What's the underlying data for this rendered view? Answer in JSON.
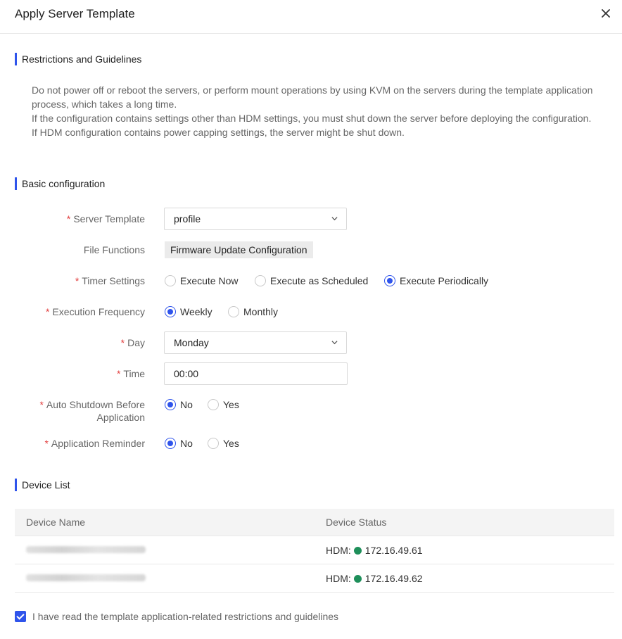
{
  "dialog": {
    "title": "Apply Server Template",
    "close_icon": "close-icon"
  },
  "restrictions": {
    "title": "Restrictions and Guidelines",
    "lines": [
      "Do not power off or reboot the servers, or perform mount operations by using KVM on the servers during the template application process, which takes a long time.",
      "If the configuration contains settings other than HDM settings, you must shut down the server before deploying the configuration.",
      "If HDM configuration contains power capping settings, the server might be shut down."
    ]
  },
  "basic": {
    "title": "Basic configuration",
    "server_template": {
      "label": "Server Template",
      "value": "profile"
    },
    "file_functions": {
      "label": "File Functions",
      "value": "Firmware Update Configuration"
    },
    "timer_settings": {
      "label": "Timer Settings",
      "options": [
        "Execute Now",
        "Execute as Scheduled",
        "Execute Periodically"
      ],
      "selected": "Execute Periodically"
    },
    "execution_frequency": {
      "label": "Execution Frequency",
      "options": [
        "Weekly",
        "Monthly"
      ],
      "selected": "Weekly"
    },
    "day": {
      "label": "Day",
      "value": "Monday"
    },
    "time": {
      "label": "Time",
      "value": "00:00"
    },
    "auto_shutdown": {
      "label_line1": "Auto Shutdown Before",
      "label_line2": "Application",
      "options": [
        "No",
        "Yes"
      ],
      "selected": "No"
    },
    "application_reminder": {
      "label": "Application Reminder",
      "options": [
        "No",
        "Yes"
      ],
      "selected": "No"
    },
    "required_mark": "*"
  },
  "device_list": {
    "title": "Device List",
    "columns": [
      "Device Name",
      "Device Status"
    ],
    "rows": [
      {
        "status_prefix": "HDM:",
        "ip": "172.16.49.61",
        "status_color": "#1e8f5a"
      },
      {
        "status_prefix": "HDM:",
        "ip": "172.16.49.62",
        "status_color": "#1e8f5a"
      }
    ]
  },
  "agreement": {
    "label": "I have read the template application-related restrictions and guidelines",
    "checked": true
  },
  "colors": {
    "accent": "#2f54eb",
    "required": "#e23d3d",
    "online": "#1e8f5a"
  }
}
